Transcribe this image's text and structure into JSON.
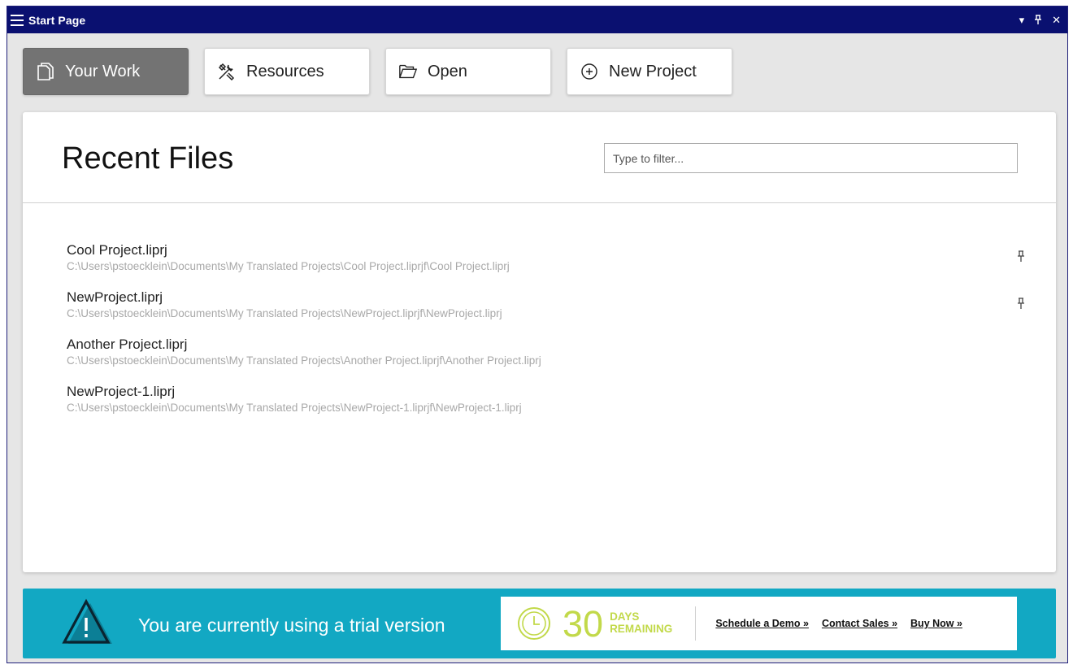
{
  "window": {
    "title": "Start Page",
    "controls": {
      "dropdown": "▾",
      "pin": "ᛘ",
      "close": "✕"
    }
  },
  "nav": {
    "buttons": [
      {
        "label": "Your Work",
        "icon": "document-icon",
        "active": true
      },
      {
        "label": "Resources",
        "icon": "tools-icon",
        "active": false
      },
      {
        "label": "Open",
        "icon": "folder-open-icon",
        "active": false
      },
      {
        "label": "New Project",
        "icon": "plus-circle-icon",
        "active": false
      }
    ]
  },
  "recent": {
    "title": "Recent Files",
    "filter_placeholder": "Type to filter...",
    "files": [
      {
        "name": "Cool Project.liprj",
        "path": "C:\\Users\\pstoecklein\\Documents\\My Translated Projects\\Cool Project.liprjf\\Cool Project.liprj",
        "pinned": true
      },
      {
        "name": "NewProject.liprj",
        "path": "C:\\Users\\pstoecklein\\Documents\\My Translated Projects\\NewProject.liprjf\\NewProject.liprj",
        "pinned": true
      },
      {
        "name": "Another Project.liprj",
        "path": "C:\\Users\\pstoecklein\\Documents\\My Translated Projects\\Another Project.liprjf\\Another Project.liprj",
        "pinned": false
      },
      {
        "name": "NewProject-1.liprj",
        "path": "C:\\Users\\pstoecklein\\Documents\\My Translated Projects\\NewProject-1.liprjf\\NewProject-1.liprj",
        "pinned": false
      }
    ]
  },
  "trial": {
    "message": "You are currently using a trial version",
    "days": "30",
    "days_label_1": "DAYS",
    "days_label_2": "REMAINING",
    "links": [
      "Schedule a Demo »",
      "Contact Sales »",
      "Buy Now »"
    ]
  },
  "colors": {
    "titlebar": "#0a1070",
    "active_nav": "#737373",
    "banner": "#12a8c3",
    "trial_accent": "#c2d94a"
  }
}
